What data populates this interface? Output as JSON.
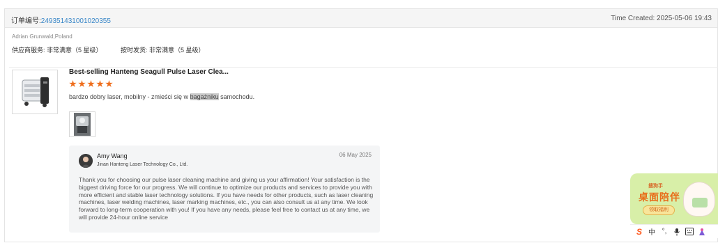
{
  "order": {
    "label": "订单编号:",
    "number": "249351431001020355",
    "time_created": "Time Created: 2025-05-06 19:43"
  },
  "buyer": {
    "name_country": "Adrian Grunwald,Poland",
    "supplier_service": "供应商服务: 非常满意（5 星级）",
    "on_time_delivery": "按时发货: 非常满意（5 星级）"
  },
  "product": {
    "title": "Best-selling Hanteng Seagull Pulse Laser Clea...",
    "rating_stars": 5,
    "review_before": "bardzo dobry laser, mobilny - zmieści się w ",
    "review_highlight": "bagażniku",
    "review_after": " samochodu."
  },
  "reply": {
    "name": "Amy Wang",
    "company": "Jinan Hanteng Laser Technology Co., Ltd.",
    "date": "06 May 2025",
    "body": "Thank you for choosing our pulse laser cleaning machine and giving us your affirmation! Your satisfaction is the biggest driving force for our progress. We will continue to optimize our products and services to provide you with more efficient and stable laser technology solutions. If you have needs for other products, such as laser cleaning machines, laser welding machines, laser marking machines, etc., you can also consult us at any time. We look forward to long-term cooperation with you! If you have any needs, please feel free to contact us at any time, we will provide 24-hour online service"
  },
  "widget": {
    "small_text": "搜狗手",
    "title": "桌面陪伴",
    "button": "领取福利"
  },
  "ime_toolbar": {
    "logo": "S",
    "lang": "中",
    "punct": "°,",
    "items": [
      "mic-icon",
      "keyboard-icon",
      "skin-icon"
    ]
  },
  "colors": {
    "order_number": "#3a87c8",
    "stars": "#ee6d1c",
    "reply_bg": "#f4f5f6"
  }
}
